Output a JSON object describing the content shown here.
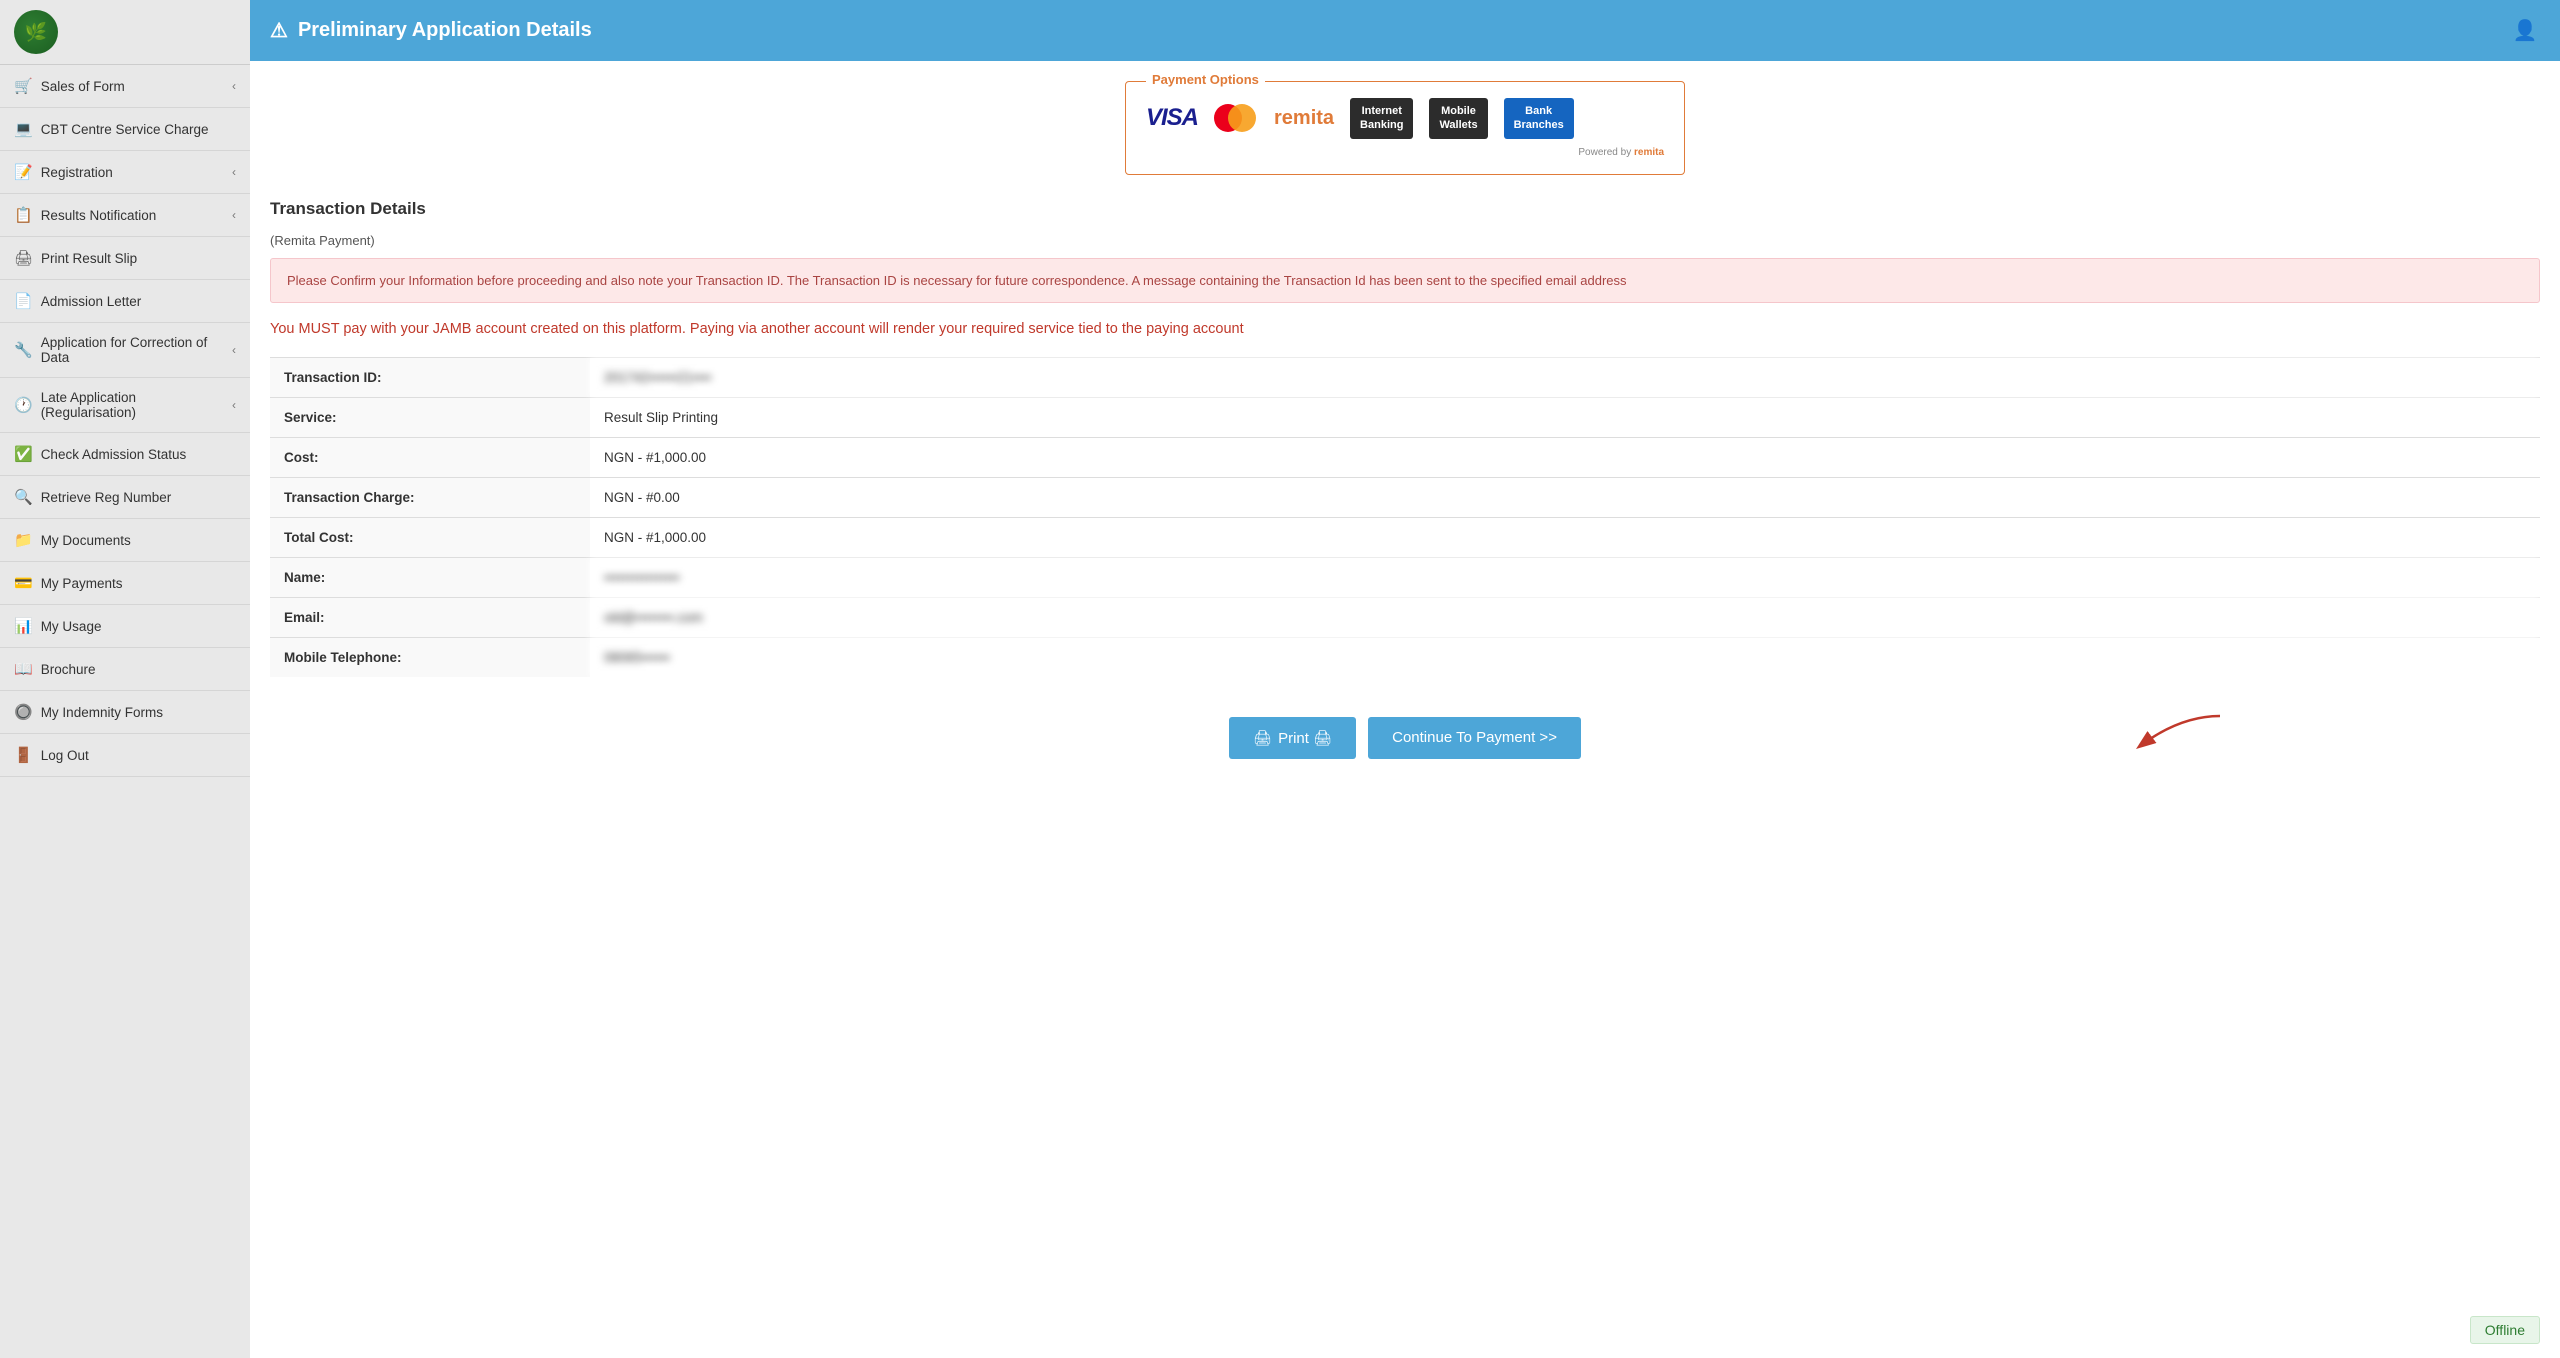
{
  "sidebar": {
    "items": [
      {
        "id": "sales-of-form",
        "label": "Sales of Form",
        "icon": "🛒",
        "hasChevron": true
      },
      {
        "id": "cbt-centre",
        "label": "CBT Centre Service Charge",
        "icon": "💻",
        "hasChevron": false
      },
      {
        "id": "registration",
        "label": "Registration",
        "icon": "📝",
        "hasChevron": true
      },
      {
        "id": "results-notification",
        "label": "Results Notification",
        "icon": "📋",
        "hasChevron": true
      },
      {
        "id": "print-result-slip",
        "label": "Print Result Slip",
        "icon": "🖨",
        "hasChevron": false
      },
      {
        "id": "admission-letter",
        "label": "Admission Letter",
        "icon": "📄",
        "hasChevron": false
      },
      {
        "id": "application-correction",
        "label": "Application for Correction of Data",
        "icon": "🔧",
        "hasChevron": true
      },
      {
        "id": "late-application",
        "label": "Late Application (Regularisation)",
        "icon": "🕐",
        "hasChevron": true
      },
      {
        "id": "check-admission",
        "label": "Check Admission Status",
        "icon": "✅",
        "hasChevron": false
      },
      {
        "id": "retrieve-reg",
        "label": "Retrieve Reg Number",
        "icon": "🔍",
        "hasChevron": false
      },
      {
        "id": "my-documents",
        "label": "My Documents",
        "icon": "📁",
        "hasChevron": false
      },
      {
        "id": "my-payments",
        "label": "My Payments",
        "icon": "💳",
        "hasChevron": false
      },
      {
        "id": "my-usage",
        "label": "My Usage",
        "icon": "📊",
        "hasChevron": false
      },
      {
        "id": "brochure",
        "label": "Brochure",
        "icon": "📖",
        "hasChevron": false
      },
      {
        "id": "my-indemnity",
        "label": "My Indemnity Forms",
        "icon": "🔘",
        "hasChevron": false
      },
      {
        "id": "log-out",
        "label": "Log Out",
        "icon": "🚪",
        "hasChevron": false
      }
    ]
  },
  "header": {
    "title": "Preliminary Application Details",
    "warning_icon": "⚠"
  },
  "payment_options": {
    "label": "Payment Options",
    "powered_by": "Powered by",
    "remita_text": "remita",
    "internet_banking": "Internet\nBanking",
    "mobile_wallets": "Mobile\nWallets",
    "bank_branches": "Bank\nBranches"
  },
  "transaction": {
    "section_title": "Transaction Details",
    "remita_label": "(Remita Payment)",
    "alert_message": "Please Confirm your Information before proceeding and also note your Transaction ID. The Transaction ID is necessary for future correspondence. A message containing the Transaction Id has been sent to the specified email address",
    "warning_text": "You MUST pay with your JAMB account created on this platform. Paying via another account will render your required service tied to the paying account",
    "rows": [
      {
        "label": "Transaction ID:",
        "value": "201742••••••21••••",
        "blurred": true
      },
      {
        "label": "Service:",
        "value": "Result Slip Printing",
        "blurred": false
      },
      {
        "label": "Cost:",
        "value": "NGN - #1,000.00",
        "blurred": false
      },
      {
        "label": "Transaction Charge:",
        "value": "NGN - #0.00",
        "blurred": false
      },
      {
        "label": "Total Cost:",
        "value": "NGN - #1,000.00",
        "blurred": false
      },
      {
        "label": "Name:",
        "value": "••••••••••••••••",
        "blurred": true
      },
      {
        "label": "Email:",
        "value": "old@••••••••.com",
        "blurred": true
      },
      {
        "label": "Mobile Telephone:",
        "value": "08065••••••",
        "blurred": true
      }
    ]
  },
  "buttons": {
    "print_label": "Print 🖨",
    "continue_label": "Continue To Payment >>"
  },
  "status": {
    "offline_label": "Offline"
  }
}
